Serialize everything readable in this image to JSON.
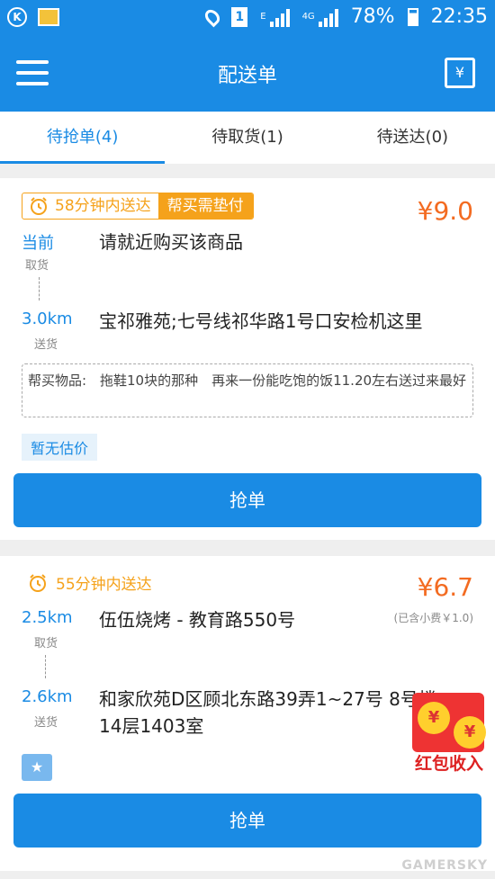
{
  "status_bar": {
    "left_badge": "K",
    "sim_slot": "1",
    "network_e": "E",
    "network_4g": "4G",
    "battery": "78%",
    "time": "22:35"
  },
  "appbar": {
    "title": "配送单",
    "right_icon_glyph": "¥"
  },
  "tabs": [
    {
      "label": "待抢单(4)",
      "active": true
    },
    {
      "label": "待取货(1)",
      "active": false
    },
    {
      "label": "待送达(0)",
      "active": false
    }
  ],
  "orders": [
    {
      "time_limit": "58分钟内送达",
      "tag": "帮买需垫付",
      "price": "¥9.0",
      "pickup_distance": "当前",
      "pickup_sub": "取货",
      "pickup_address": "请就近购买该商品",
      "delivery_distance": "3.0km",
      "delivery_sub": "送货",
      "delivery_address": "宝祁雅苑;七号线祁华路1号口安检机这里",
      "goods_label": "帮买物品:",
      "goods_value": "拖鞋10块的那种　再来一份能吃饱的饭11.20左右送过来最好",
      "estimate_tag": "暂无估价",
      "grab_label": "抢单"
    },
    {
      "time_limit": "55分钟内送达",
      "price": "¥6.7",
      "price_note": "(已含小费￥1.0)",
      "pickup_distance": "2.5km",
      "pickup_sub": "取货",
      "pickup_address": "伍伍烧烤 - 教育路550号",
      "delivery_distance": "2.6km",
      "delivery_sub": "送货",
      "delivery_address": "和家欣苑D区顾北东路39弄1~27号 8号楼14层1403室",
      "star_glyph": "★",
      "grab_label": "抢单"
    }
  ],
  "overlay": {
    "redpack_coin": "¥",
    "redpack_text": "红包收入",
    "watermark": "GAMERSKY"
  },
  "colors": {
    "primary": "#1a8be4",
    "orange": "#f5a21b",
    "price": "#f36b21"
  }
}
